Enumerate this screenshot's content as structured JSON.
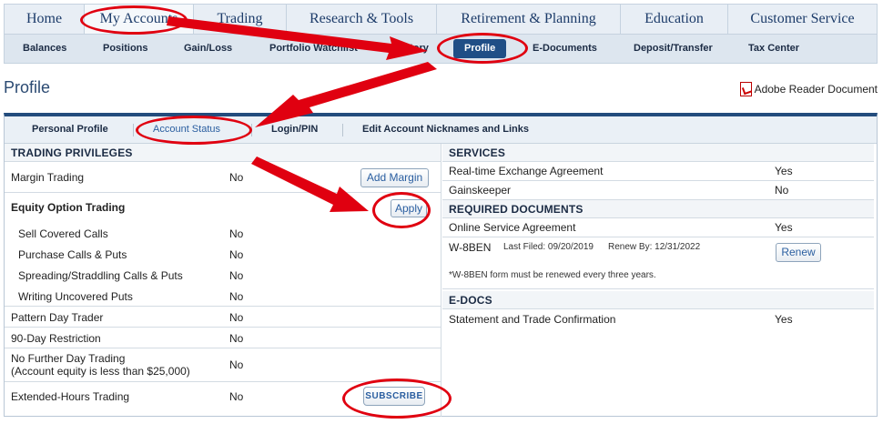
{
  "main_nav": {
    "items": [
      "Home",
      "My Accounts",
      "Trading",
      "Research & Tools",
      "Retirement & Planning",
      "Education",
      "Customer Service"
    ],
    "active_index": 1
  },
  "sub_nav": {
    "items": [
      "Balances",
      "Positions",
      "Gain/Loss",
      "Portfolio Watchlist",
      "History",
      "Profile",
      "E-Documents",
      "Deposit/Transfer",
      "Tax Center"
    ],
    "active_index": 5
  },
  "page": {
    "title": "Profile",
    "adobe_link": "Adobe Reader Document"
  },
  "profile_tabs": {
    "items": [
      "Personal Profile",
      "Account Status",
      "Login/PIN",
      "Edit Account Nicknames and Links"
    ],
    "active_index": 1
  },
  "trading_privileges": {
    "heading": "TRADING PRIVILEGES",
    "margin": {
      "label": "Margin Trading",
      "value": "No",
      "button": "Add Margin"
    },
    "options": {
      "label": "Equity Option Trading",
      "button": "Apply",
      "items": [
        {
          "label": "Sell Covered Calls",
          "value": "No"
        },
        {
          "label": "Purchase Calls & Puts",
          "value": "No"
        },
        {
          "label": "Spreading/Straddling Calls & Puts",
          "value": "No"
        },
        {
          "label": "Writing Uncovered Puts",
          "value": "No"
        }
      ]
    },
    "pattern_day": {
      "label": "Pattern Day Trader",
      "value": "No"
    },
    "ninety_day": {
      "label": "90-Day Restriction",
      "value": "No"
    },
    "no_further": {
      "label": "No Further Day Trading",
      "sublabel": "(Account equity is less than $25,000)",
      "value": "No"
    },
    "extended": {
      "label": "Extended-Hours Trading",
      "value": "No",
      "button": "SUBSCRIBE"
    }
  },
  "services": {
    "heading": "SERVICES",
    "items": [
      {
        "label": "Real-time Exchange Agreement",
        "value": "Yes"
      },
      {
        "label": "Gainskeeper",
        "value": "No"
      }
    ]
  },
  "required_documents": {
    "heading": "REQUIRED DOCUMENTS",
    "online_service": {
      "label": "Online Service Agreement",
      "value": "Yes"
    },
    "w8ben": {
      "label": "W-8BEN",
      "last_filed": "Last Filed: 09/20/2019",
      "renew_by": "Renew By: 12/31/2022",
      "button": "Renew",
      "note": "*W-8BEN form must be renewed every three years."
    }
  },
  "edocs": {
    "heading": "E-DOCS",
    "items": [
      {
        "label": "Statement and Trade Confirmation",
        "value": "Yes"
      }
    ]
  },
  "colors": {
    "annotation": "#e00010",
    "nav_active": "#1f4e86",
    "panel_top": "#234c7d",
    "link_blue": "#2a5ea0"
  }
}
